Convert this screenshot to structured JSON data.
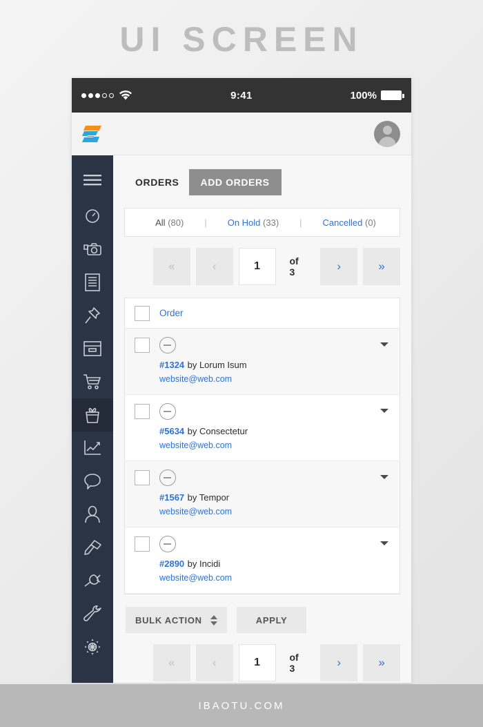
{
  "banner": {
    "title": "UI SCREEN"
  },
  "footer": {
    "text": "IBAOTU.COM"
  },
  "statusbar": {
    "time": "9:41",
    "battery_pct": "100%"
  },
  "sidebar": {
    "items": [
      {
        "icon": "hamburger-menu-icon",
        "name": "menu"
      },
      {
        "icon": "dashboard-gauge-icon",
        "name": "dashboard"
      },
      {
        "icon": "media-camera-icon",
        "name": "media"
      },
      {
        "icon": "document-post-icon",
        "name": "posts"
      },
      {
        "icon": "pin-icon",
        "name": "pages"
      },
      {
        "icon": "window-frame-icon",
        "name": "appearance"
      },
      {
        "icon": "shopping-cart-icon",
        "name": "orders"
      },
      {
        "icon": "gift-box-icon",
        "name": "products"
      },
      {
        "icon": "line-chart-icon",
        "name": "analytics"
      },
      {
        "icon": "comment-bubble-icon",
        "name": "comments"
      },
      {
        "icon": "user-icon",
        "name": "users"
      },
      {
        "icon": "paint-brush-icon",
        "name": "themes"
      },
      {
        "icon": "plug-icon",
        "name": "plugins"
      },
      {
        "icon": "wrench-icon",
        "name": "tools"
      },
      {
        "icon": "gear-icon",
        "name": "settings"
      }
    ],
    "active_index": 7
  },
  "topbar": {
    "avatar": "user-avatar"
  },
  "tabs": {
    "orders_label": "ORDERS",
    "add_orders_label": "ADD ORDERS"
  },
  "filters": [
    {
      "label": "All",
      "count": "(80)",
      "active": true
    },
    {
      "label": "On Hold",
      "count": "(33)",
      "active": false
    },
    {
      "label": "Cancelled",
      "count": "(0)",
      "active": false
    }
  ],
  "filter_separator": "|",
  "pagination": {
    "first_label": "«",
    "prev_label": "‹",
    "current_page": "1",
    "of_label": "of 3",
    "next_label": "›",
    "last_label": "»"
  },
  "table": {
    "header": {
      "order_label": "Order"
    },
    "rows": [
      {
        "id": "#1324",
        "by": "by Lorum Isum",
        "email": "website@web.com"
      },
      {
        "id": "#5634",
        "by": "by Consectetur",
        "email": "website@web.com"
      },
      {
        "id": "#1567",
        "by": "by Tempor",
        "email": "website@web.com"
      },
      {
        "id": "#2890",
        "by": "by Incidi",
        "email": "website@web.com"
      }
    ]
  },
  "bulk": {
    "action_label": "BULK ACTION",
    "apply_label": "APPLY"
  },
  "colors": {
    "link_blue": "#2f72d4",
    "sidebar_bg": "#2b3444",
    "sidebar_active": "#232b38",
    "accent_orange": "#f39019",
    "accent_blue": "#2ba6e0"
  }
}
